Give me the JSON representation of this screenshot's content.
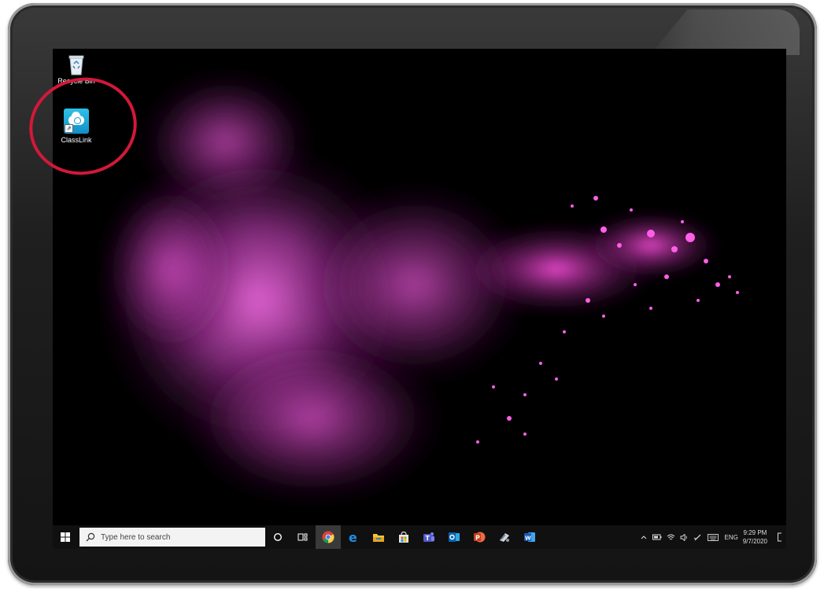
{
  "desktop": {
    "icons": [
      {
        "label": "Recycle Bin",
        "icon": "recycle-bin-icon"
      },
      {
        "label": "ClassLink",
        "icon": "classlink-cloud-icon"
      }
    ]
  },
  "taskbar": {
    "search_placeholder": "Type here to search",
    "pinned_apps": [
      "cortana-icon",
      "task-view-icon",
      "chrome-icon",
      "edge-icon",
      "file-explorer-icon",
      "store-icon",
      "teams-icon",
      "outlook-icon",
      "powerpoint-icon",
      "snip-sketch-icon",
      "word-icon"
    ],
    "tray": {
      "language": "ENG",
      "time": "9:29 PM",
      "date": "9/7/2020"
    }
  },
  "colors": {
    "annotation": "#d3183a",
    "wallpaper_accent": "#e040c8",
    "classlink_tile": "#1ba6dc",
    "taskbar": "#101010"
  }
}
